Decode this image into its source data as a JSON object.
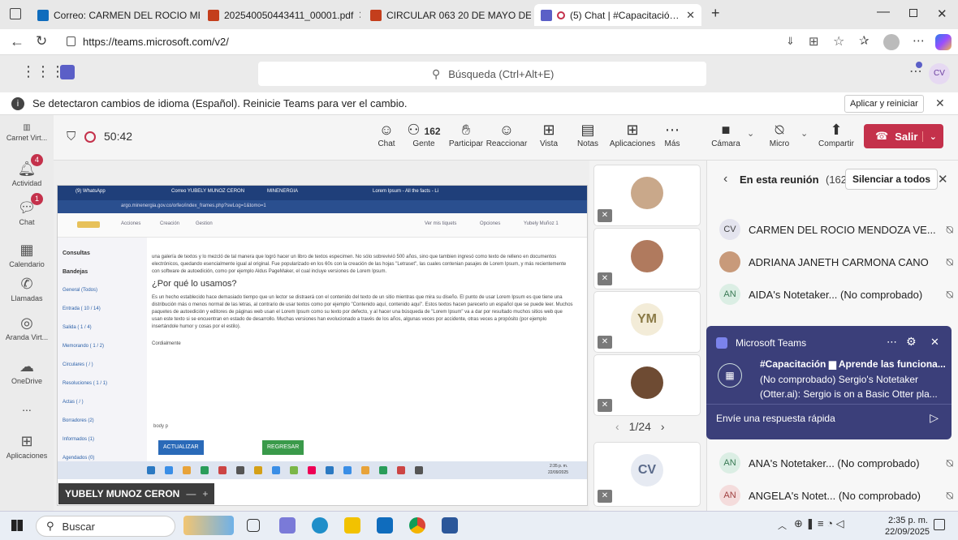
{
  "browser": {
    "tabs": [
      {
        "label": "Correo: CARMEN DEL ROCIO ME",
        "color": "#0f6cbd"
      },
      {
        "label": "202540050443411_00001.pdf",
        "color": "#c43e1c"
      },
      {
        "label": "CIRCULAR 063 20 DE MAYO DE 2(",
        "color": "#c43e1c"
      },
      {
        "label": "(5) Chat | #Capacitación ▆ A",
        "color": "#5b5fc7"
      }
    ],
    "url": "https://teams.microsoft.com/v2/"
  },
  "teams": {
    "search_placeholder": "Búsqueda (Ctrl+Alt+E)",
    "user_initials": "CV",
    "notice": "Se detectaron cambios de idioma (Español). Reinicie Teams para ver el cambio.",
    "notice_action": "Aplicar y reiniciar"
  },
  "rail": [
    {
      "label": "Carnet Virt...",
      "icon": "apps-icon"
    },
    {
      "label": "Actividad",
      "icon": "bell-icon",
      "badge": "4"
    },
    {
      "label": "Chat",
      "icon": "chat-icon",
      "badge": "1"
    },
    {
      "label": "Calendario",
      "icon": "calendar-icon"
    },
    {
      "label": "Llamadas",
      "icon": "phone-icon"
    },
    {
      "label": "Aranda Virt...",
      "icon": "headset-icon"
    },
    {
      "label": "OneDrive",
      "icon": "cloud-icon"
    },
    {
      "label": "...",
      "icon": "more-icon"
    },
    {
      "label": "Aplicaciones",
      "icon": "plus-icon"
    }
  ],
  "meeting": {
    "timer": "50:42",
    "people_count": "162",
    "tools": [
      {
        "label": "Chat",
        "icon": "chat-icon"
      },
      {
        "label": "Gente",
        "icon": "people-icon"
      },
      {
        "label": "Participar",
        "icon": "raise-hand-icon"
      },
      {
        "label": "Reaccionar",
        "icon": "smile-icon"
      },
      {
        "label": "Vista",
        "icon": "grid-icon"
      },
      {
        "label": "Notas",
        "icon": "notes-icon"
      },
      {
        "label": "Aplicaciones",
        "icon": "plus-icon"
      },
      {
        "label": "Más",
        "icon": "more-icon"
      },
      {
        "label": "Cámara",
        "icon": "camera-off-icon"
      },
      {
        "label": "Micro",
        "icon": "mic-off-icon"
      },
      {
        "label": "Compartir",
        "icon": "share-icon"
      }
    ],
    "leave_label": "Salir",
    "presenter_label": "YUBELY MUNOZ CERON",
    "page": "1/24"
  },
  "shared_screen": {
    "tabs": [
      "(9) WhatsApp",
      "Correo YUBELY MUNOZ CERON",
      "MINENERGIA",
      "Lorem Ipsum - All the facts - Li"
    ],
    "url": "argo.minenergia.gov.co/orfeo/index_frames.php?swLog=1&tomo=1",
    "menu": [
      "Acciones",
      "Creación",
      "Gestion"
    ],
    "right_menu": [
      "Ver mis tiquets",
      "Opciones",
      "Yubely Muñoz 1"
    ],
    "sidebar": [
      "Consultas",
      "Bandejas",
      "General (Todos)",
      "Entrada ( 10 / 14)",
      "Salida ( 1 / 4)",
      "Memorando ( 1 / 2)",
      "Circulares ( / )",
      "Resoluciones ( 1 / 1)",
      "Actas ( / )",
      "Borradores (2)",
      "Informados (1)",
      "Agendados (0)"
    ],
    "para1": "una galería de textos y lo mezcló de tal manera que logró hacer un libro de textos especimen. No sólo sobrevivió 500 años, sino que tambien ingresó como texto de relleno en documentos electrónicos, quedando esencialmente igual al original. Fue popularizado en los 60s con la creación de las hojas \"Letraset\", las cuales contenian pasajes de Lorem Ipsum, y más recientemente con software de autoedición, como por ejemplo Aldus PageMaker, el cual incluye versiones de Lorem Ipsum.",
    "heading": "¿Por qué lo usamos?",
    "para2": "Es un hecho establecido hace demasiado tiempo que un lector se distraerá con el contenido del texto de un sitio mientras que mira su diseño. El punto de usar Lorem Ipsum es que tiene una distribución más o menos normal de las letras, al contrario de usar textos como por ejemplo \"Contenido aquí, contenido aquí\". Estos textos hacen parecerlo un español que se puede leer. Muchos paquetes de autoedición y editores de páginas web usan el Lorem Ipsum como su texto por defecto, y al hacer una búsqueda de \"Lorem Ipsum\" va a dar por resultado muchos sitios web que usan este texto si se encuentran en estado de desarrollo. Muchas versiones han evolucionado a través de los años, algunas veces por accidente, otras veces a propósito (por ejemplo insertándole humor y cosas por el estilo).",
    "closing": "Cordialmente",
    "editor_path": "body  p",
    "btn_update": "ACTUALIZAR",
    "btn_back": "REGRESAR",
    "clock_time": "2:35 p. m.",
    "clock_date": "22/09/2025"
  },
  "tiles": [
    {
      "type": "photo",
      "color": "#c9a88a"
    },
    {
      "type": "photo",
      "color": "#b07a5e"
    },
    {
      "type": "initials",
      "text": "YM"
    },
    {
      "type": "photo",
      "color": "#6e4b33"
    },
    {
      "type": "initials",
      "text": "CV"
    }
  ],
  "panel": {
    "title": "En esta reunión",
    "count": "(162)",
    "mute_all": "Silenciar a todos",
    "people": [
      {
        "initials": "CV",
        "name": "CARMEN DEL ROCIO MENDOZA VE..."
      },
      {
        "initials": "",
        "name": "ADRIANA JANETH CARMONA CANO"
      },
      {
        "initials": "AN",
        "name": "AIDA's Notetaker... (No comprobado)"
      },
      {
        "initials": "AN",
        "name": "ANA's Notetaker... (No comprobado)"
      },
      {
        "initials": "AN",
        "name": "ANGELA's Notet... (No comprobado)"
      }
    ]
  },
  "toast": {
    "app": "Microsoft Teams",
    "title": "#Capacitación ▆ Aprende las funciona...",
    "body1": "(No comprobado) Sergio's Notetaker",
    "body2": "(Otter.ai): Sergio is on a Basic Otter pla...",
    "reply_placeholder": "Envíe una respuesta rápida"
  },
  "taskbar": {
    "search": "Buscar",
    "time": "2:35 p. m.",
    "date": "22/09/2025"
  }
}
